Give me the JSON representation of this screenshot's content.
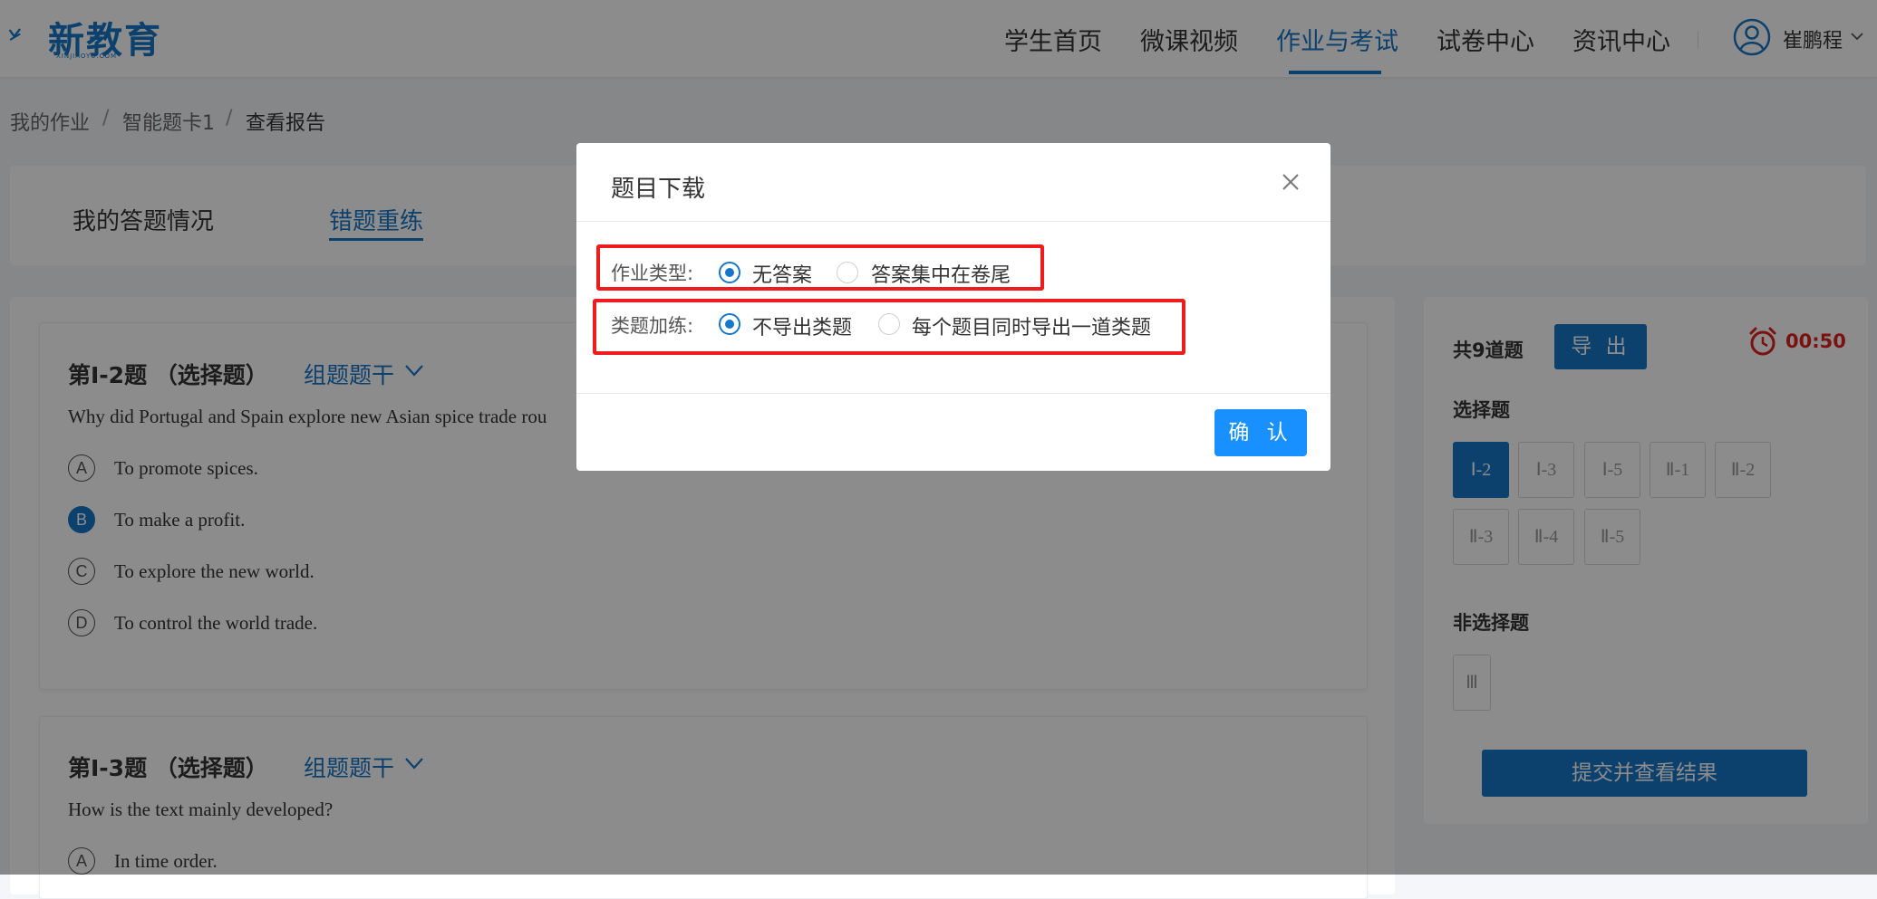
{
  "header": {
    "logo_text": "新教育",
    "logo_sub": "XINJIAOYU.COM",
    "nav": [
      "学生首页",
      "微课视频",
      "作业与考试",
      "试卷中心",
      "资讯中心"
    ],
    "user_name": "崔鹏程"
  },
  "breadcrumb": [
    "我的作业",
    "智能题卡1",
    "查看报告"
  ],
  "tabs": [
    "我的答题情况",
    "错题重练"
  ],
  "questions": [
    {
      "title": "第Ⅰ-2题 （选择题）",
      "group_label": "组题题干",
      "text": "Why did Portugal and Spain explore new Asian spice trade rou",
      "options": [
        {
          "letter": "A",
          "text": "To promote spices."
        },
        {
          "letter": "B",
          "text": "To make a profit."
        },
        {
          "letter": "C",
          "text": "To explore the new world."
        },
        {
          "letter": "D",
          "text": "To control the world trade."
        }
      ]
    },
    {
      "title": "第Ⅰ-3题 （选择题）",
      "group_label": "组题题干",
      "text": "How is the text mainly developed?",
      "options": [
        {
          "letter": "A",
          "text": "In time order."
        }
      ]
    }
  ],
  "side": {
    "total": "共9道题",
    "export": "导 出",
    "timer": "00:50",
    "choice_title": "选择题",
    "choice_nums": [
      "Ⅰ-2",
      "Ⅰ-3",
      "Ⅰ-5",
      "Ⅱ-1",
      "Ⅱ-2",
      "Ⅱ-3",
      "Ⅱ-4",
      "Ⅱ-5"
    ],
    "nonchoice_title": "非选择题",
    "nonchoice_nums": [
      "Ⅲ"
    ],
    "submit": "提交并查看结果"
  },
  "modal": {
    "title": "题目下载",
    "row1_label": "作业类型:",
    "row1_options": [
      "无答案",
      "答案集中在卷尾"
    ],
    "row2_label": "类题加练:",
    "row2_options": [
      "不导出类题",
      "每个题目同时导出一道类题"
    ],
    "confirm": "确 认"
  },
  "colors": {
    "primary": "#1677c8",
    "highlight": "#ee1c1c",
    "danger": "#e02020"
  }
}
